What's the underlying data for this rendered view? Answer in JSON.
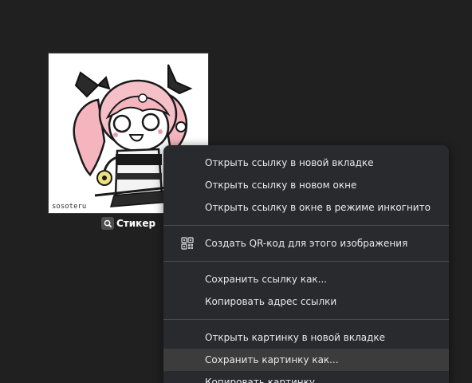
{
  "sticker": {
    "caption": "Стикер",
    "icon": "search-icon",
    "watermark": "sosoteru"
  },
  "context_menu": {
    "groups": [
      {
        "items": [
          {
            "label": "Открыть ссылку в новой вкладке"
          },
          {
            "label": "Открыть ссылку в новом окне"
          },
          {
            "label": "Открыть ссылку в окне в режиме инкогнито"
          }
        ]
      },
      {
        "items": [
          {
            "label": "Создать QR-код для этого изображения",
            "icon": "qr-code-icon"
          }
        ]
      },
      {
        "items": [
          {
            "label": "Сохранить ссылку как..."
          },
          {
            "label": "Копировать адрес ссылки"
          }
        ]
      },
      {
        "items": [
          {
            "label": "Открыть картинку в новой вкладке"
          },
          {
            "label": "Сохранить картинку как...",
            "highlighted": true
          },
          {
            "label": "Копировать картинку"
          }
        ]
      }
    ]
  },
  "colors": {
    "background": "#202020",
    "menu_background": "#292a2d",
    "menu_text": "#e8eaed",
    "highlight": "#3c3c3c",
    "separator": "#4b4c4f"
  }
}
